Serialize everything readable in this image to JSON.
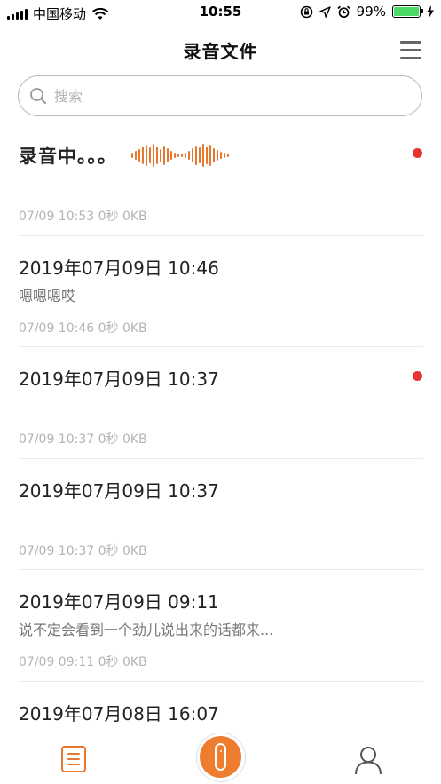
{
  "status_bar": {
    "carrier": "中国移动",
    "time": "10:55",
    "battery_percent": "99%",
    "battery_level": 0.99
  },
  "header": {
    "title": "录音文件"
  },
  "search": {
    "placeholder": "搜索"
  },
  "recording": {
    "title": "录音中。。。",
    "meta": "07/09 10:53 0秒 0KB"
  },
  "recordings": [
    {
      "title": "2019年07月09日 10:46",
      "subtitle": "嗯嗯嗯哎",
      "meta": "07/09 10:46 0秒 0KB",
      "unread": false
    },
    {
      "title": "2019年07月09日 10:37",
      "subtitle": "",
      "meta": "07/09 10:37 0秒 0KB",
      "unread": true
    },
    {
      "title": "2019年07月09日 10:37",
      "subtitle": "",
      "meta": "07/09 10:37 0秒 0KB",
      "unread": false
    },
    {
      "title": "2019年07月09日 09:11",
      "subtitle": "说不定会看到一个劲儿说出来的话都来...",
      "meta": "07/09 09:11 0秒 0KB",
      "unread": false
    },
    {
      "title": "2019年07月08日 16:07",
      "subtitle": "",
      "meta": "",
      "unread": false
    }
  ],
  "colors": {
    "accent": "#ee7d30",
    "unread_dot": "#e8322b",
    "battery": "#4cd964"
  },
  "icons": {
    "search": "search-icon",
    "menu": "menu-icon",
    "files_tab": "document-list-icon",
    "record": "microphone-icon",
    "profile": "person-icon"
  }
}
